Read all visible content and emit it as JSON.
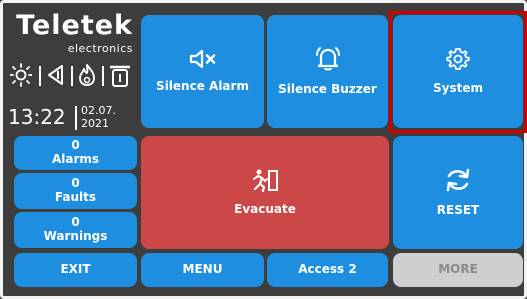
{
  "branding": {
    "logo_text": "Teletek",
    "sub_text": "electronics"
  },
  "status_icons": [
    "sun-icon",
    "arrow-left-icon",
    "flame-icon",
    "device-icon"
  ],
  "clock": {
    "time": "13:22",
    "date_line1": "02.07.",
    "date_line2": "2021"
  },
  "top_buttons": {
    "silence_alarm": "Silence Alarm",
    "silence_buzzer": "Silence Buzzer",
    "system": "System"
  },
  "counters": {
    "alarms": {
      "count": "0",
      "label": "Alarms"
    },
    "faults": {
      "count": "0",
      "label": "Faults"
    },
    "warnings": {
      "count": "0",
      "label": "Warnings"
    }
  },
  "main_buttons": {
    "evacuate": "Evacuate",
    "reset": "RESET"
  },
  "bottom_buttons": {
    "exit": "EXIT",
    "menu": "MENU",
    "access": "Access 2",
    "more": "MORE"
  },
  "colors": {
    "accent": "#1e8fe0",
    "danger": "#cc4747",
    "disabled": "#cfcfcf",
    "selection": "#d40000"
  }
}
